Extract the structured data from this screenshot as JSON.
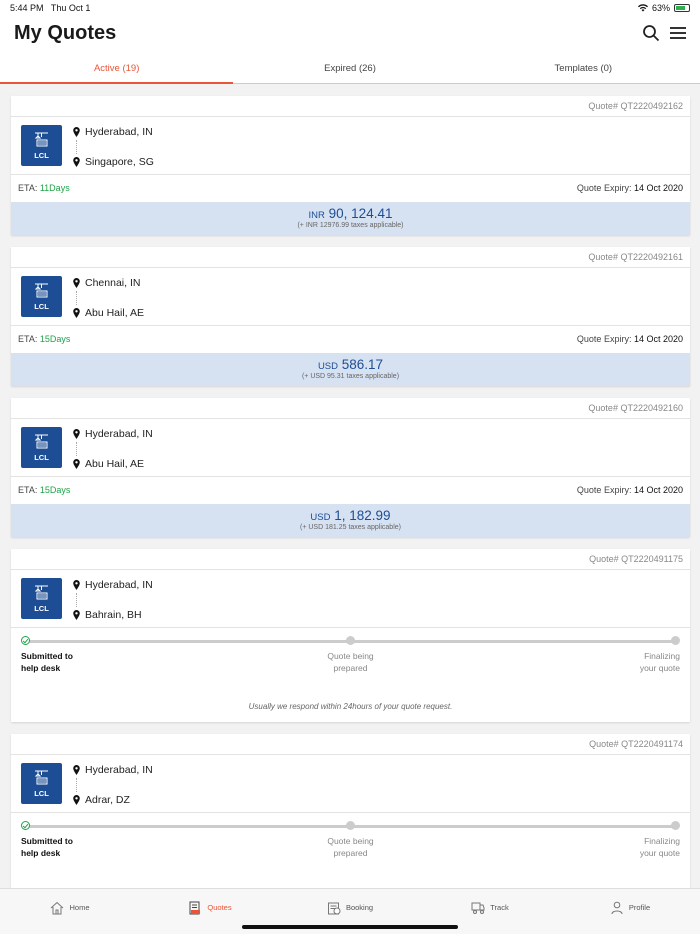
{
  "status": {
    "time": "5:44 PM",
    "date": "Thu Oct 1",
    "battery": "63%"
  },
  "header": {
    "title": "My Quotes"
  },
  "tabs": [
    {
      "label": "Active (19)",
      "active": true
    },
    {
      "label": "Expired (26)",
      "active": false
    },
    {
      "label": "Templates (0)",
      "active": false
    }
  ],
  "quotes": [
    {
      "quote_no": "Quote# QT2220492162",
      "mode": "LCL",
      "from": "Hyderabad, IN",
      "to": "Singapore, SG",
      "eta_label": "ETA: ",
      "eta": "11Days",
      "expiry_label": "Quote Expiry: ",
      "expiry": "14 Oct 2020",
      "currency": "INR",
      "amount": "90, 124.41",
      "tax": "(+ INR 12976.99 taxes applicable)"
    },
    {
      "quote_no": "Quote# QT2220492161",
      "mode": "LCL",
      "from": "Chennai, IN",
      "to": "Abu Hail, AE",
      "eta_label": "ETA: ",
      "eta": "15Days",
      "expiry_label": "Quote Expiry: ",
      "expiry": "14 Oct 2020",
      "currency": "USD",
      "amount": "586.17",
      "tax": "(+ USD 95.31 taxes applicable)"
    },
    {
      "quote_no": "Quote# QT2220492160",
      "mode": "LCL",
      "from": "Hyderabad, IN",
      "to": "Abu Hail, AE",
      "eta_label": "ETA: ",
      "eta": "15Days",
      "expiry_label": "Quote Expiry: ",
      "expiry": "14 Oct 2020",
      "currency": "USD",
      "amount": "1, 182.99",
      "tax": "(+ USD 181.25 taxes applicable)"
    }
  ],
  "requests": [
    {
      "quote_no": "Quote# QT2220491175",
      "mode": "LCL",
      "from": "Hyderabad, IN",
      "to": "Bahrain, BH",
      "steps": [
        "Submitted to\nhelp desk",
        "Quote being\nprepared",
        "Finalizing\nyour quote"
      ],
      "note": "Usually we respond within 24hours of your quote request."
    },
    {
      "quote_no": "Quote# QT2220491174",
      "mode": "LCL",
      "from": "Hyderabad, IN",
      "to": "Adrar, DZ",
      "steps": [
        "Submitted to\nhelp desk",
        "Quote being\nprepared",
        "Finalizing\nyour quote"
      ],
      "note": ""
    }
  ],
  "nav": [
    {
      "label": "Home",
      "icon": "home-icon",
      "active": false
    },
    {
      "label": "Quotes",
      "icon": "quotes-icon",
      "active": true
    },
    {
      "label": "Booking",
      "icon": "booking-icon",
      "active": false
    },
    {
      "label": "Track",
      "icon": "track-icon",
      "active": false
    },
    {
      "label": "Profile",
      "icon": "profile-icon",
      "active": false
    }
  ],
  "colors": {
    "accent": "#e8553a",
    "brand": "#1d4e95",
    "eta": "#20a34a",
    "price_bg": "#d6e2f1"
  }
}
